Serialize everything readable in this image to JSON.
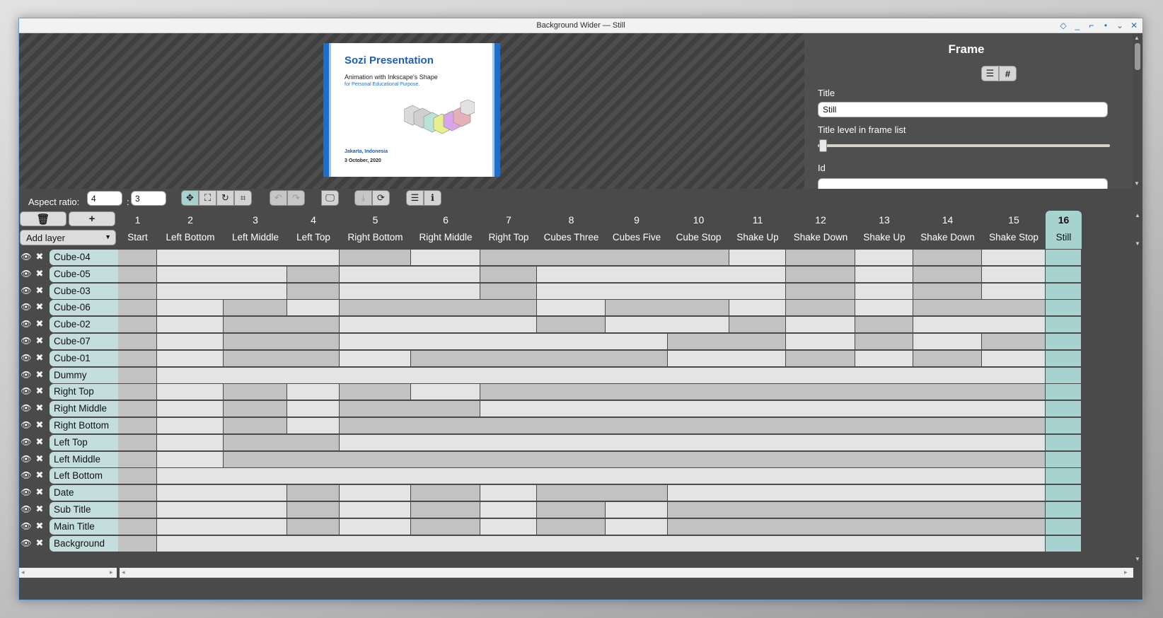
{
  "window": {
    "title": "Background Wider — Still"
  },
  "slide": {
    "title": "Sozi Presentation",
    "subtitle": "Animation with Inkscape's Shape",
    "subtitle2": "for Personal Educational Purpose.",
    "place": "Jakarta, Indonesia",
    "date": "3 October, 2020"
  },
  "props": {
    "heading": "Frame",
    "list_icon": "☰",
    "hash_icon": "#",
    "title_label": "Title",
    "title_value": "Still",
    "level_label": "Title level in frame list",
    "level_value": 0,
    "id_label": "Id"
  },
  "toolbar": {
    "aspect_label": "Aspect ratio:",
    "aspect_w": "4",
    "aspect_h": "3",
    "colon": ":"
  },
  "timeline": {
    "delete_icon": "🗑",
    "add_icon": "+",
    "add_layer": "Add layer",
    "frames": [
      {
        "num": "1",
        "title": "Start"
      },
      {
        "num": "2",
        "title": "Left Bottom"
      },
      {
        "num": "3",
        "title": "Left Middle"
      },
      {
        "num": "4",
        "title": "Left Top"
      },
      {
        "num": "5",
        "title": "Right Bottom"
      },
      {
        "num": "6",
        "title": "Right Middle"
      },
      {
        "num": "7",
        "title": "Right Top"
      },
      {
        "num": "8",
        "title": "Cubes Three"
      },
      {
        "num": "9",
        "title": "Cubes Five"
      },
      {
        "num": "10",
        "title": "Cube Stop"
      },
      {
        "num": "11",
        "title": "Shake Up"
      },
      {
        "num": "12",
        "title": "Shake Down"
      },
      {
        "num": "13",
        "title": "Shake Up"
      },
      {
        "num": "14",
        "title": "Shake Down"
      },
      {
        "num": "15",
        "title": "Shake Stop"
      },
      {
        "num": "16",
        "title": "Still"
      }
    ],
    "selected_frame": 16,
    "layers": [
      {
        "name": "Cube-04",
        "pattern": "DLLLDLDDDDLDLDLS"
      },
      {
        "name": "Cube-05",
        "pattern": "DLLDLLDLLLLDLDLS"
      },
      {
        "name": "Cube-03",
        "pattern": "DLLDLLDLLLLDLDLS"
      },
      {
        "name": "Cube-06",
        "pattern": "DLDLDDDLDDLDLDDS"
      },
      {
        "name": "Cube-02",
        "pattern": "DLDDLLLDLLDLDLLS"
      },
      {
        "name": "Cube-07",
        "pattern": "DLDDLLLLLDDLDLDS"
      },
      {
        "name": "Cube-01",
        "pattern": "DLDDLDDDDLLDLDLS"
      },
      {
        "name": "Dummy",
        "pattern": "DLLLLLLLLLLLLLLS"
      },
      {
        "name": "Right Top",
        "pattern": "DLDLDLDDDDDDDDDS"
      },
      {
        "name": "Right Middle",
        "pattern": "DLDLDDLLLLLLLLLS"
      },
      {
        "name": "Right Bottom",
        "pattern": "DLDLDDDDDDDDDDDS"
      },
      {
        "name": "Left Top",
        "pattern": "DLDDLLLLLLLLLLLS"
      },
      {
        "name": "Left Middle",
        "pattern": "DLDDDDDDDDDDDDDS"
      },
      {
        "name": "Left Bottom",
        "pattern": "DLLLLLLLLLLLLLLS"
      },
      {
        "name": "Date",
        "pattern": "DLLDLDLDDLLLLLLS"
      },
      {
        "name": "Sub Title",
        "pattern": "DLLDLDLDLDDDDDDS"
      },
      {
        "name": "Main Title",
        "pattern": "DLLDLDLDLDDDDDDS"
      },
      {
        "name": "Background",
        "pattern": "DLLLLLLLLLLLLLLS"
      }
    ]
  },
  "colors": {
    "accent": "#a7d2d0",
    "cell_light": "#e4e4e4",
    "cell_dark": "#c2c2c2",
    "window_border": "#6c9fd6"
  }
}
